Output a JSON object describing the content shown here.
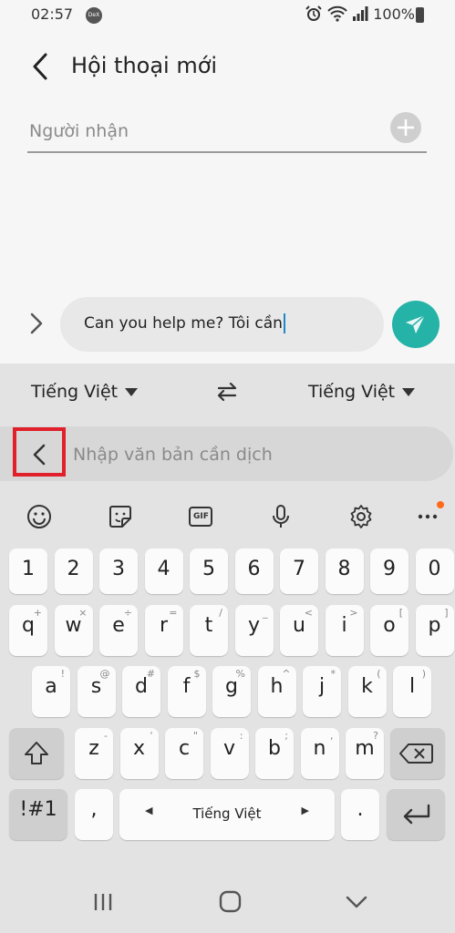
{
  "status": {
    "time": "02:57",
    "dex": "DeX",
    "battery": "100%"
  },
  "header": {
    "title": "Hội thoại mới"
  },
  "recipient": {
    "placeholder": "Người nhận"
  },
  "compose": {
    "text": "Can you help me? Tôi cần"
  },
  "translator": {
    "from_language": "Tiếng Việt",
    "to_language": "Tiếng Việt",
    "input_placeholder": "Nhập văn bản cần dịch"
  },
  "toolbar": {
    "icons": [
      "emoji-icon",
      "sticker-icon",
      "gif-icon",
      "mic-icon",
      "settings-icon",
      "more-icon"
    ],
    "gif_label": "GIF"
  },
  "keyboard": {
    "number_row": [
      "1",
      "2",
      "3",
      "4",
      "5",
      "6",
      "7",
      "8",
      "9",
      "0"
    ],
    "row1": [
      {
        "k": "q",
        "h": "+"
      },
      {
        "k": "w",
        "h": "×"
      },
      {
        "k": "e",
        "h": "÷"
      },
      {
        "k": "r",
        "h": "="
      },
      {
        "k": "t",
        "h": "/"
      },
      {
        "k": "y",
        "h": "_"
      },
      {
        "k": "u",
        "h": "<"
      },
      {
        "k": "i",
        "h": ">"
      },
      {
        "k": "o",
        "h": "["
      },
      {
        "k": "p",
        "h": "]"
      }
    ],
    "row2": [
      {
        "k": "a",
        "h": "!"
      },
      {
        "k": "s",
        "h": "@"
      },
      {
        "k": "d",
        "h": "#"
      },
      {
        "k": "f",
        "h": "$"
      },
      {
        "k": "g",
        "h": "%"
      },
      {
        "k": "h",
        "h": "^"
      },
      {
        "k": "j",
        "h": "*"
      },
      {
        "k": "k",
        "h": "("
      },
      {
        "k": "l",
        "h": ")"
      }
    ],
    "row3": [
      {
        "k": "z",
        "h": "-"
      },
      {
        "k": "x",
        "h": "'"
      },
      {
        "k": "c",
        "h": "\""
      },
      {
        "k": "v",
        "h": ":"
      },
      {
        "k": "b",
        "h": ";"
      },
      {
        "k": "n",
        "h": ","
      },
      {
        "k": "m",
        "h": "?"
      }
    ],
    "symbols_label": "!#1",
    "comma_label": ",",
    "space_label": "Tiếng Việt",
    "period_label": "."
  }
}
